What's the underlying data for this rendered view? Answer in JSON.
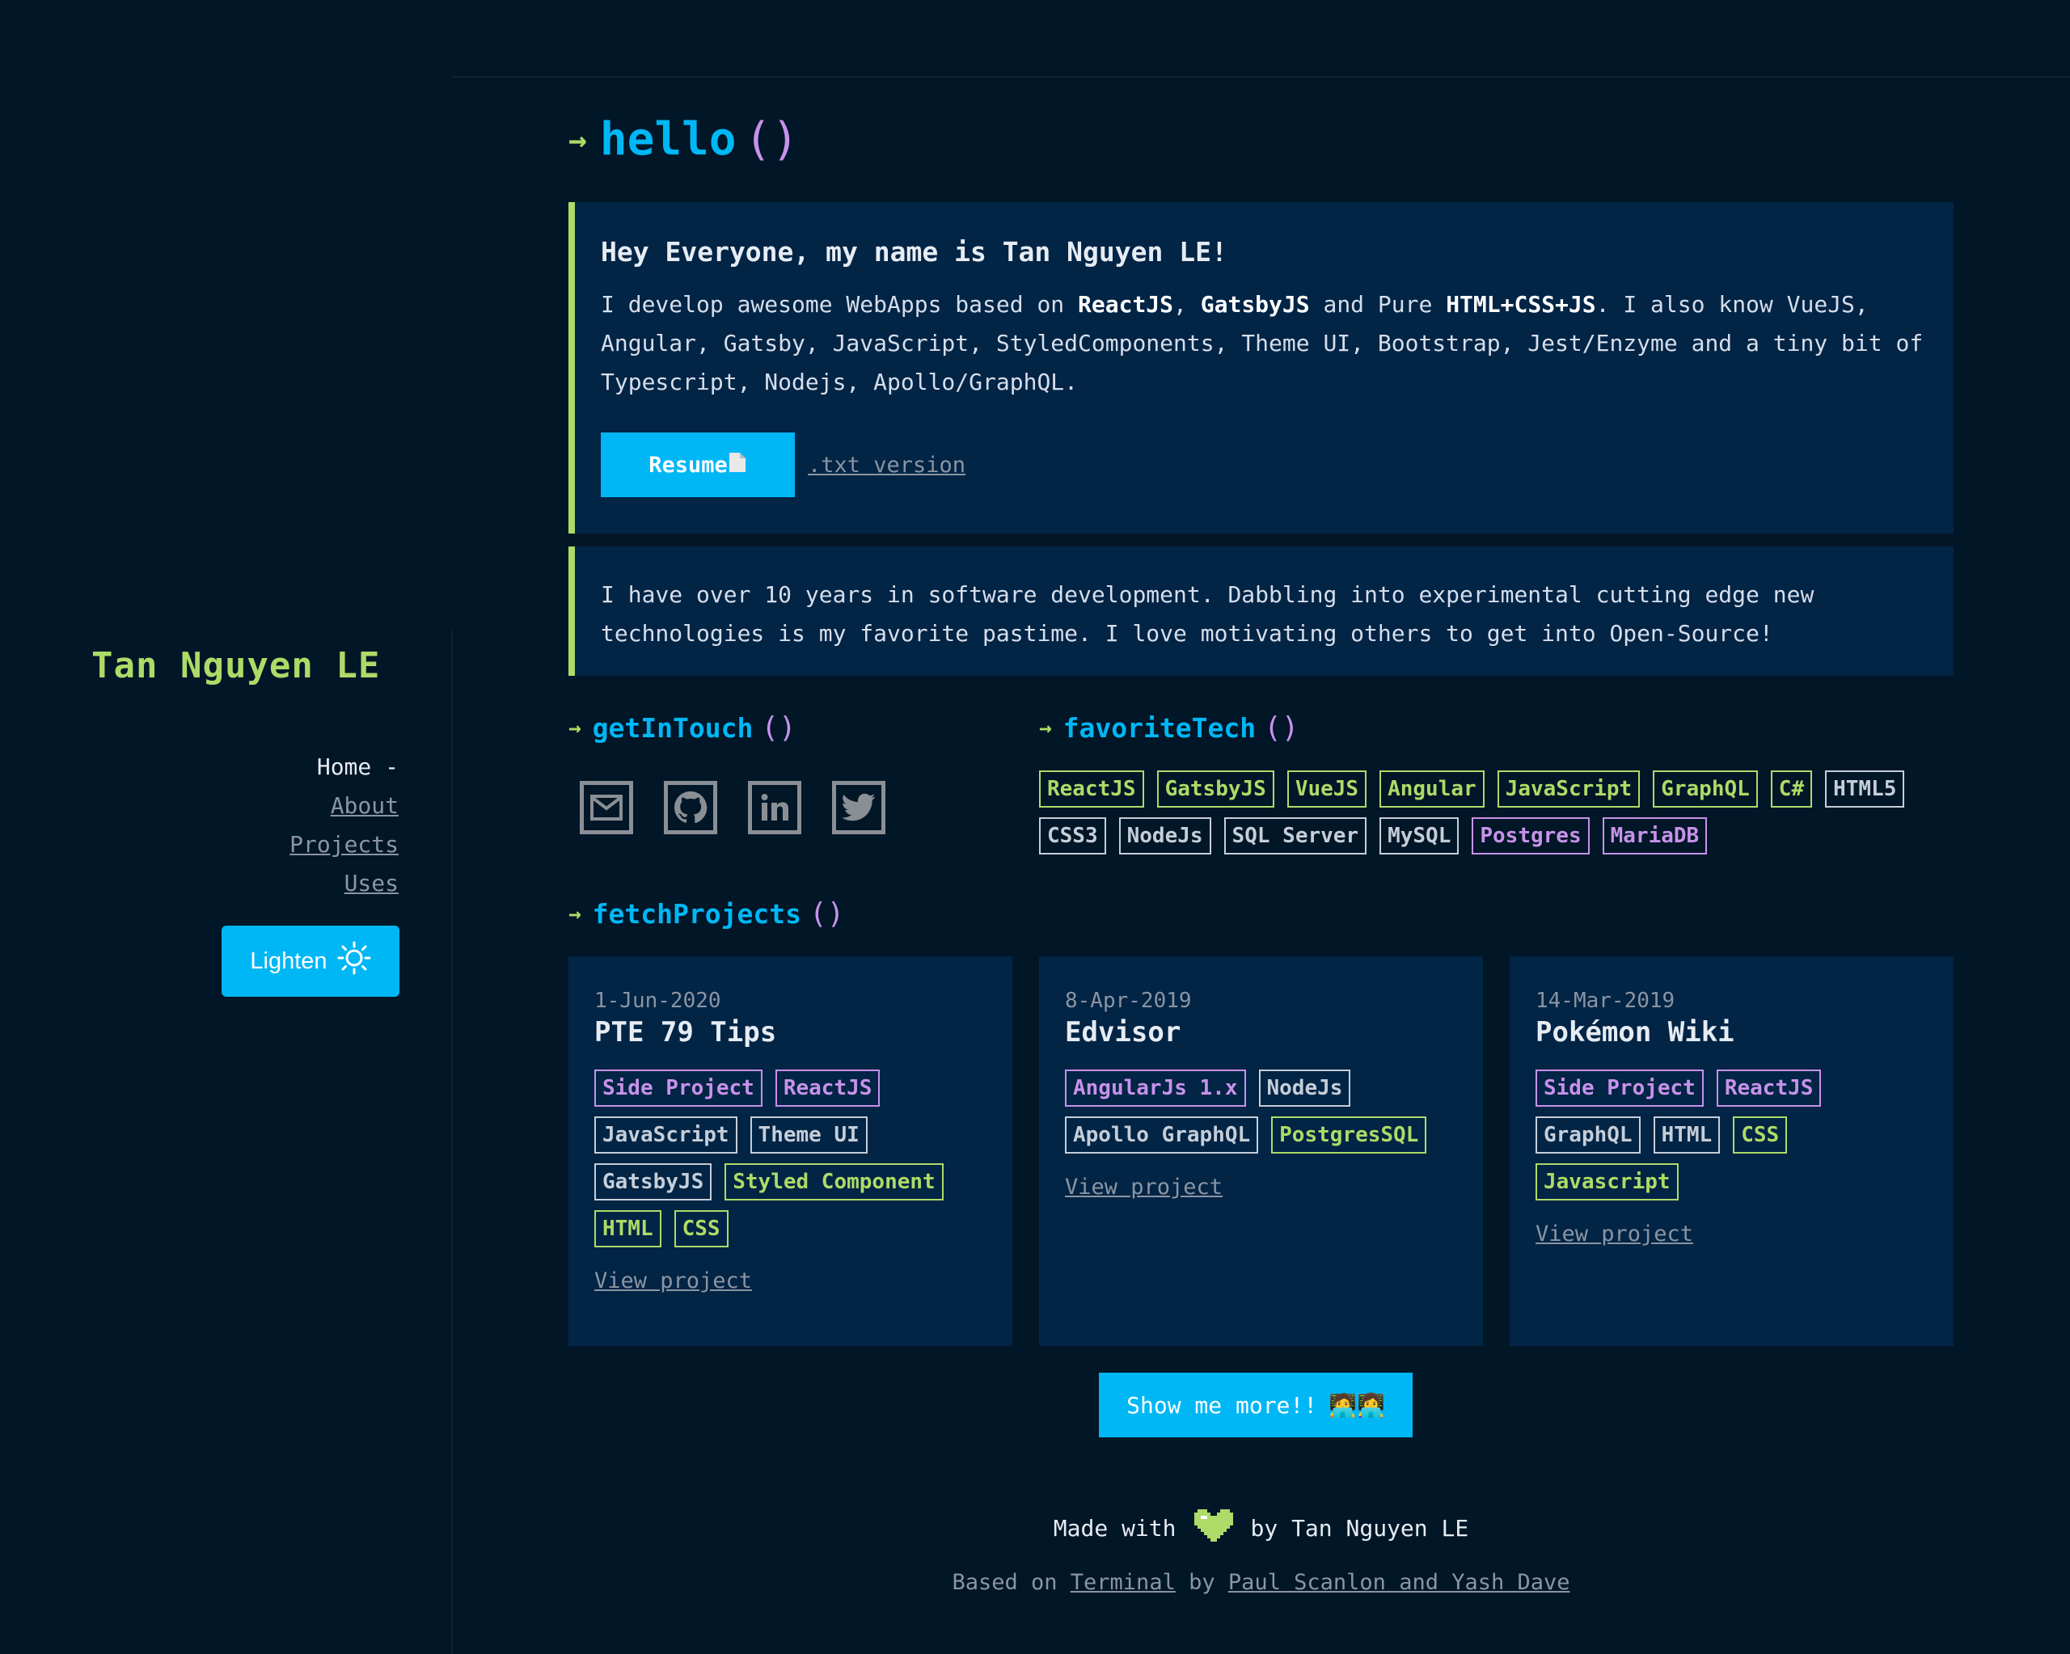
{
  "sidebar": {
    "name": "Tan Nguyen LE",
    "nav": {
      "home": "Home -",
      "about": "About",
      "projects": "Projects",
      "uses": "Uses"
    },
    "theme_button": "Lighten",
    "theme_icon": "sun-icon"
  },
  "hello": {
    "arrow": "→",
    "title": "hello",
    "paren": "()"
  },
  "intro": {
    "heading": "Hey Everyone, my name is Tan Nguyen LE!",
    "p1_a": "I develop awesome WebApps based on ",
    "p1_b": "ReactJS",
    "p1_c": ", ",
    "p1_d": "GatsbyJS",
    "p1_e": " and Pure ",
    "p1_f": "HTML+CSS+JS",
    "p1_g": ". I also know VueJS, Angular, Gatsby, JavaScript, StyledComponents, Theme UI, Bootstrap, Jest/Enzyme and a tiny bit of Typescript, Nodejs, Apollo/GraphQL.",
    "resume_button": "Resume",
    "resume_icon": "document-icon",
    "txt_link": ".txt version"
  },
  "about": {
    "text": "I have over 10 years in software development. Dabbling into experimental cutting edge new technologies is my favorite pastime. I love motivating others to get into Open-Source!"
  },
  "getInTouch": {
    "title": "getInTouch",
    "paren": "()",
    "icons": [
      "mail-icon",
      "github-icon",
      "linkedin-icon",
      "twitter-icon"
    ]
  },
  "favoriteTech": {
    "title": "favoriteTech",
    "paren": "()",
    "tags": [
      {
        "label": "ReactJS",
        "color": "g"
      },
      {
        "label": "GatsbyJS",
        "color": "g"
      },
      {
        "label": "VueJS",
        "color": "g"
      },
      {
        "label": "Angular",
        "color": "g"
      },
      {
        "label": "JavaScript",
        "color": "g"
      },
      {
        "label": "GraphQL",
        "color": "g"
      },
      {
        "label": "C#",
        "color": "g"
      },
      {
        "label": "HTML5",
        "color": "w"
      },
      {
        "label": "CSS3",
        "color": "w"
      },
      {
        "label": "NodeJs",
        "color": "w"
      },
      {
        "label": "SQL Server",
        "color": "w"
      },
      {
        "label": "MySQL",
        "color": "w"
      },
      {
        "label": "Postgres",
        "color": "p"
      },
      {
        "label": "MariaDB",
        "color": "p"
      }
    ]
  },
  "fetchProjects": {
    "title": "fetchProjects",
    "paren": "()",
    "projects": [
      {
        "date": "1-Jun-2020",
        "title": "PTE 79 Tips",
        "tags": [
          {
            "label": "Side Project",
            "color": "p"
          },
          {
            "label": "ReactJS",
            "color": "p"
          },
          {
            "label": "JavaScript",
            "color": "w"
          },
          {
            "label": "Theme UI",
            "color": "w"
          },
          {
            "label": "GatsbyJS",
            "color": "w"
          },
          {
            "label": "Styled Component",
            "color": "g"
          },
          {
            "label": "HTML",
            "color": "g"
          },
          {
            "label": "CSS",
            "color": "g"
          }
        ],
        "link": "View project"
      },
      {
        "date": "8-Apr-2019",
        "title": "Edvisor",
        "tags": [
          {
            "label": "AngularJs 1.x",
            "color": "p"
          },
          {
            "label": "NodeJs",
            "color": "w"
          },
          {
            "label": "Apollo GraphQL",
            "color": "w"
          },
          {
            "label": "PostgresSQL",
            "color": "g"
          }
        ],
        "link": "View project"
      },
      {
        "date": "14-Mar-2019",
        "title": "Pokémon Wiki",
        "tags": [
          {
            "label": "Side Project",
            "color": "p"
          },
          {
            "label": "ReactJS",
            "color": "p"
          },
          {
            "label": "GraphQL",
            "color": "w"
          },
          {
            "label": "HTML",
            "color": "w"
          },
          {
            "label": "CSS",
            "color": "g"
          },
          {
            "label": "Javascript",
            "color": "g"
          }
        ],
        "link": "View project"
      }
    ],
    "more_button": "Show me more!!",
    "more_emoji": "🧑‍💻👩‍💻"
  },
  "footer": {
    "made_with": "Made with",
    "heart_icon": "heart-icon",
    "by": "by Tan Nguyen LE",
    "based_on": "Based on",
    "terminal": "Terminal",
    "by2": "by",
    "authors": "Paul Scanlon and Yash Dave"
  }
}
